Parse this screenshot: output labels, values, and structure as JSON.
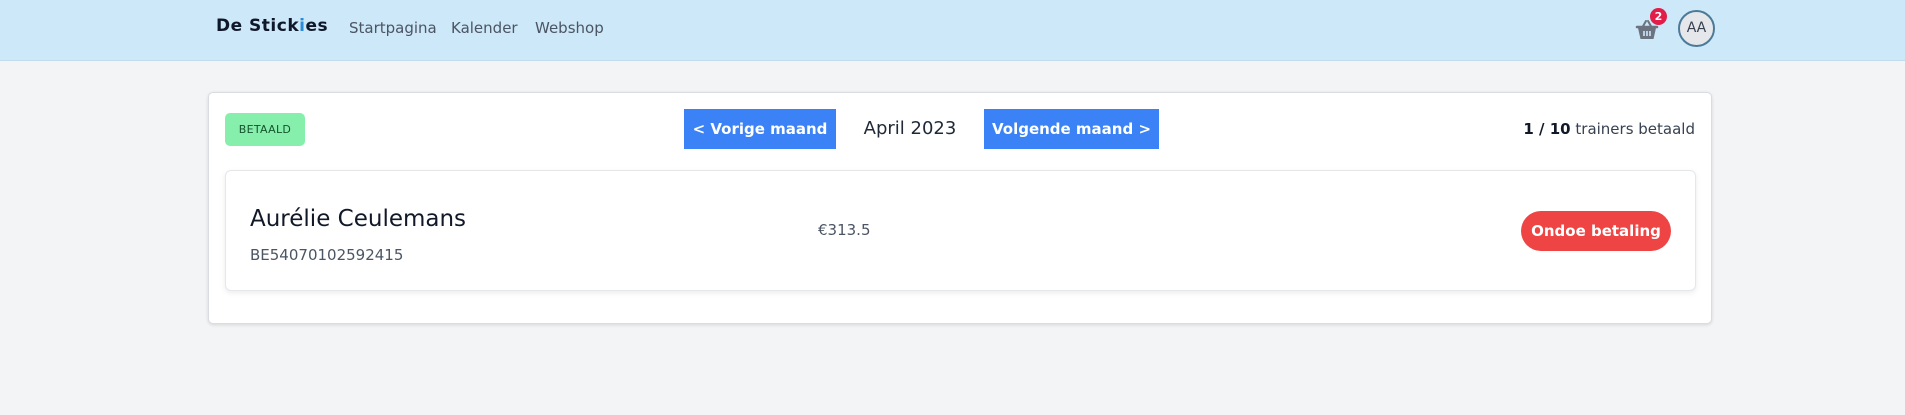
{
  "nav": {
    "logo_main": "De Stick",
    "logo_accent": "i",
    "logo_tail": "es",
    "links": [
      "Startpagina",
      "Kalender",
      "Webshop"
    ],
    "cart_icon": "basket-icon",
    "cart_count": "2",
    "avatar_initials": "AA"
  },
  "colors": {
    "navbar_bg": "#cde8f9",
    "primary_button": "#3b82f6",
    "paid_badge": "#86efac",
    "danger_button": "#ef4444",
    "cart_badge": "#e11d48"
  },
  "toolbar": {
    "status_badge": "BETAALD",
    "prev_label": "< Vorige maand",
    "month": "April 2023",
    "next_label": "Volgende maand >",
    "paid_count": "1 / 10",
    "paid_suffix": "trainers betaald"
  },
  "trainers": [
    {
      "name": "Aurélie Ceulemans",
      "iban": "BE54070102592415",
      "amount": "€313.5",
      "action_label": "Ondoe betaling"
    }
  ]
}
